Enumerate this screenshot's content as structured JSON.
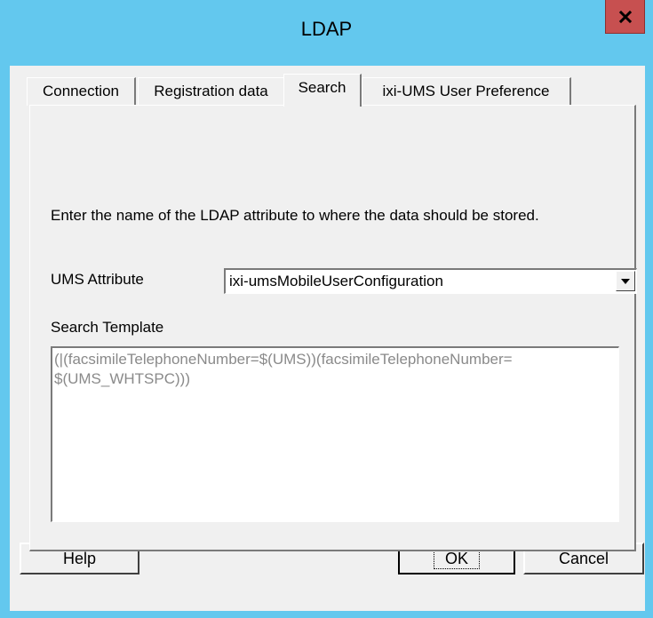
{
  "window": {
    "title": "LDAP",
    "close_glyph": "x"
  },
  "tabs": [
    {
      "label": "Connection",
      "active": false
    },
    {
      "label": "Registration data",
      "active": false
    },
    {
      "label": "Search",
      "active": true
    },
    {
      "label": "ixi-UMS User Preference",
      "active": false
    }
  ],
  "search": {
    "description": "Enter the name of the LDAP attribute to where the data should be stored.",
    "ums_attribute_label": "UMS Attribute",
    "ums_attribute_value": "ixi-umsMobileUserConfiguration",
    "template_label": "Search Template",
    "template_value": "(|(facsimileTelephoneNumber=$(UMS))(facsimileTelephoneNumber=\n$(UMS_WHTSPC)))"
  },
  "buttons": {
    "help": "Help",
    "ok": "OK",
    "cancel": "Cancel"
  },
  "icons": {
    "close": "close-icon",
    "dropdown": "chevron-down-icon"
  },
  "colors": {
    "titlebar": "#63c8ee",
    "close_button": "#c75050",
    "dialog_bg": "#f0f0f0"
  }
}
